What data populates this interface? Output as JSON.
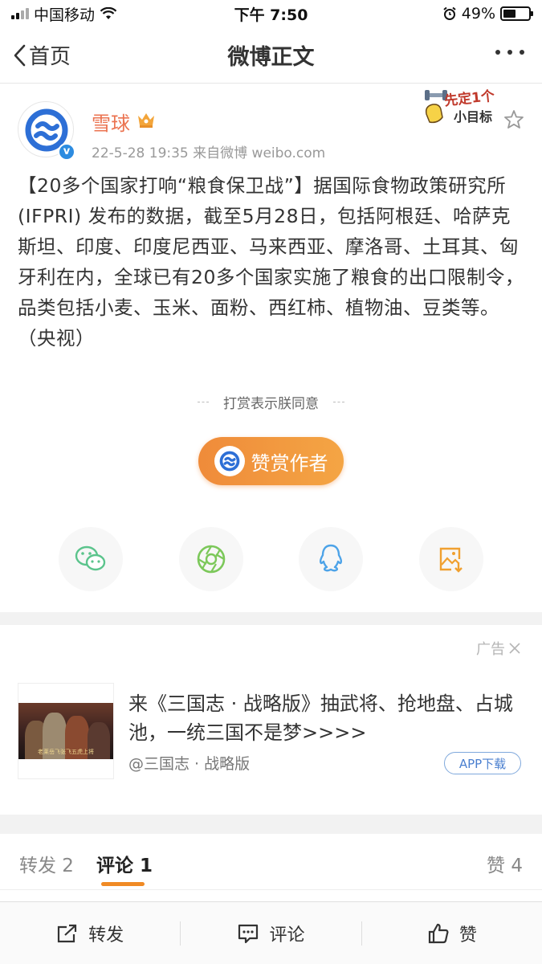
{
  "status_bar": {
    "carrier": "中国移动",
    "time": "下午 7:50",
    "battery": "49%",
    "battery_level": 0.49
  },
  "nav": {
    "back_label": "首页",
    "title": "微博正文"
  },
  "post": {
    "author": "雪球",
    "meta": "22-5-28 19:35  来自微博 weibo.com",
    "sticker_text": [
      "先定1个",
      "小目标"
    ],
    "body": "【20多个国家打响“粮食保卫战”】据国际食物政策研究所 (IFPRI) 发布的数据，截至5月28日，包括阿根廷、哈萨克斯坦、印度、印度尼西亚、马来西亚、摩洛哥、土耳其、匈牙利在内，全球已有20多个国家实施了粮食的出口限制令，品类包括小麦、玉米、面粉、西红柿、植物油、豆类等。（央视）"
  },
  "reward": {
    "note": "打赏表示朕同意",
    "button_label": "赞赏作者"
  },
  "share": {
    "icons": [
      "wechat-icon",
      "moments-icon",
      "qq-icon",
      "save-image-icon"
    ],
    "colors": {
      "wechat": "#5bc48c",
      "moments": "#7cc85a",
      "qq": "#4da3e8",
      "save": "#f0a030"
    }
  },
  "ad": {
    "label": "广告",
    "image_caption": "老莱岳飞张飞五虎上将",
    "title": "来《三国志 · 战略版》抽武将、抢地盘、占城池，一统三国不是梦>>>>",
    "source": "@三国志 · 战略版",
    "download_label": "APP下载"
  },
  "tabs": {
    "repost": "转发 2",
    "comment": "评论 1",
    "like": "赞 4"
  },
  "toolbar": {
    "repost": "转发",
    "comment": "评论",
    "like": "赞"
  },
  "colors": {
    "accent": "#f08a24",
    "username": "#eb7350",
    "logo_blue": "#2d6fd6"
  }
}
